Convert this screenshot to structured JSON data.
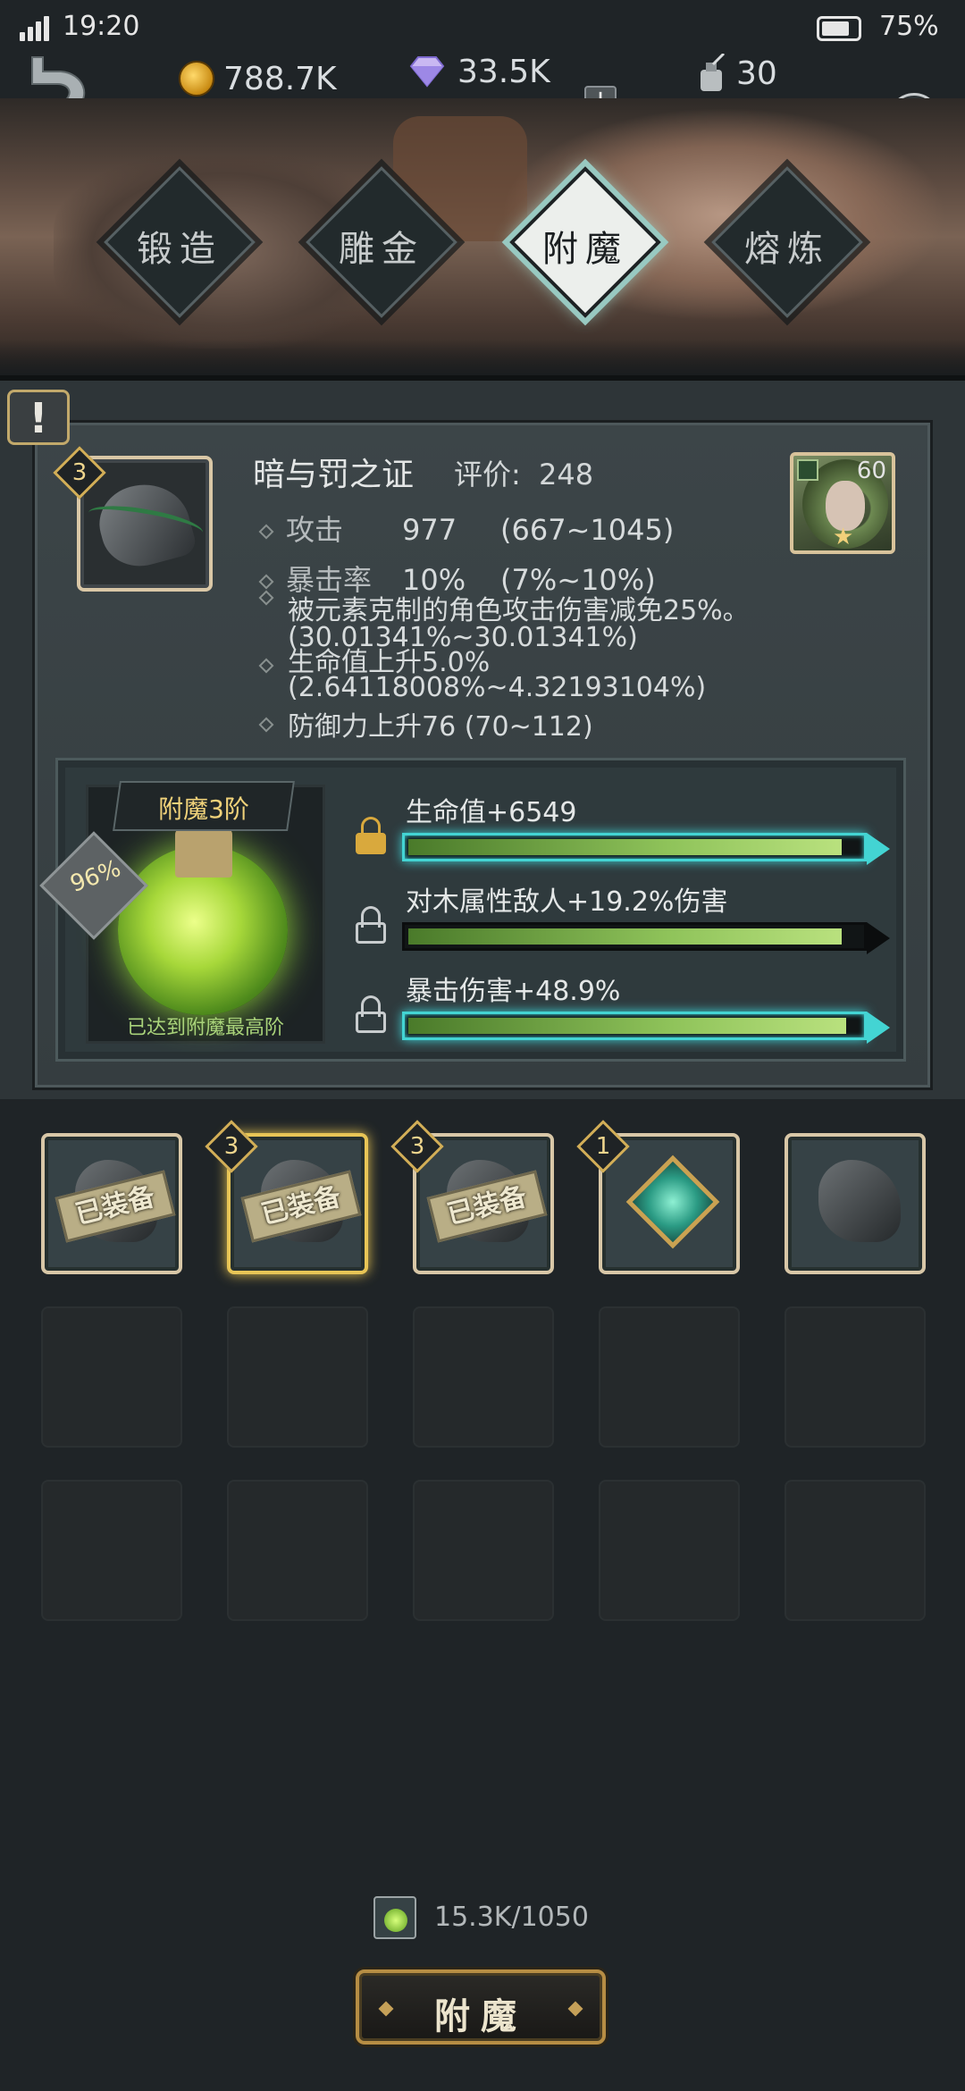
{
  "status_bar": {
    "time": "19:20",
    "battery": "75%"
  },
  "resources": {
    "coins": "788.7K",
    "gems": "33.5K",
    "ink": "30"
  },
  "tabs": [
    {
      "label": "锻造",
      "active": false
    },
    {
      "label": "雕金",
      "active": false
    },
    {
      "label": "附魔",
      "active": true
    },
    {
      "label": "熔炼",
      "active": false
    }
  ],
  "item": {
    "level_badge": "3",
    "name": "暗与罚之证",
    "rating_label": "评价:",
    "rating_value": "248",
    "hero_level": "60",
    "stats": [
      {
        "name": "攻击",
        "value": "977",
        "range": "(667~1045)"
      },
      {
        "name": "暴击率",
        "value": "10%",
        "range": "(7%~10%)"
      }
    ],
    "extra_lines": [
      "被元素克制的角色攻击伤害减免25%。",
      "(30.01341%~30.01341%)",
      "生命值上升5.0%",
      "(2.64118008%~4.32193104%)",
      "防御力上升76    (70~112)"
    ]
  },
  "enchant": {
    "title": "附魔3阶",
    "percent": "96%",
    "caption": "已达到附魔最高阶",
    "rows": [
      {
        "label": "生命值+6549",
        "fill": 0.97,
        "locked_gold": true,
        "glow": true
      },
      {
        "label": "对木属性敌人+19.2%伤害",
        "fill": 0.97,
        "locked_gold": false,
        "glow": false
      },
      {
        "label": "暴击伤害+48.9%",
        "fill": 0.98,
        "locked_gold": false,
        "glow": true
      }
    ]
  },
  "inventory": {
    "equipped_label": "已装备",
    "items": [
      {
        "badge": "",
        "equipped": true,
        "selected": false,
        "kind": "rock"
      },
      {
        "badge": "3",
        "equipped": true,
        "selected": true,
        "kind": "rock"
      },
      {
        "badge": "3",
        "equipped": true,
        "selected": false,
        "kind": "rock"
      },
      {
        "badge": "1",
        "equipped": false,
        "selected": false,
        "kind": "jewel"
      },
      {
        "badge": "",
        "equipped": false,
        "selected": false,
        "kind": "rock"
      }
    ],
    "empty_slots": 10
  },
  "cost": {
    "text": "15.3K/1050"
  },
  "action_button": {
    "label": "附魔"
  },
  "colors": {
    "accent_gold": "#d2ae57",
    "glow_cyan": "#43d4d3",
    "fill_green": "#8fc35a"
  }
}
